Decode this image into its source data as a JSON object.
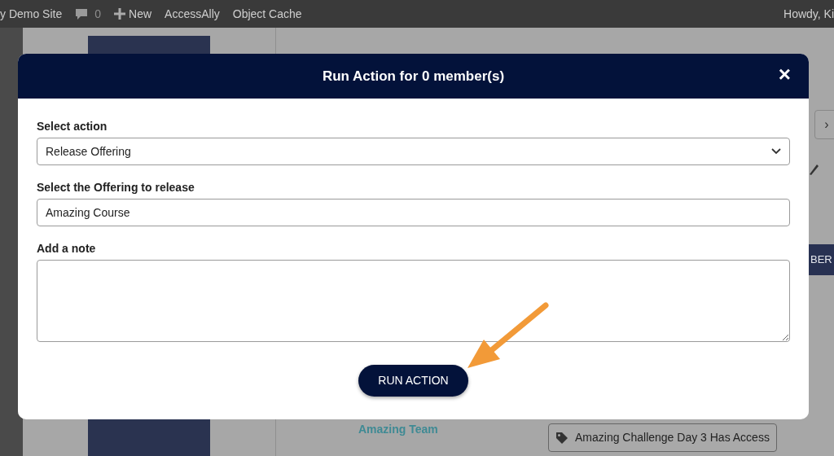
{
  "admin_bar": {
    "items": [
      {
        "kind": "text",
        "label": "y Demo Site"
      },
      {
        "kind": "comments",
        "label": "0"
      },
      {
        "kind": "new",
        "label": "New"
      },
      {
        "kind": "text",
        "label": "AccessAlly"
      },
      {
        "kind": "text",
        "label": "Object Cache"
      }
    ],
    "greeting": "Howdy, Ki"
  },
  "background": {
    "next_button": "›",
    "member_button": "BER",
    "team_link": "Amazing Team",
    "tag_button": "Amazing Challenge Day 3 Has Access"
  },
  "modal": {
    "title": "Run Action for 0 member(s)",
    "close": "×",
    "fields": [
      {
        "kind": "select",
        "label": "Select action",
        "value": "Release Offering"
      },
      {
        "kind": "input",
        "label": "Select the Offering to release",
        "value": "Amazing Course"
      },
      {
        "kind": "textarea",
        "label": "Add a note"
      }
    ],
    "submit": "RUN ACTION"
  }
}
